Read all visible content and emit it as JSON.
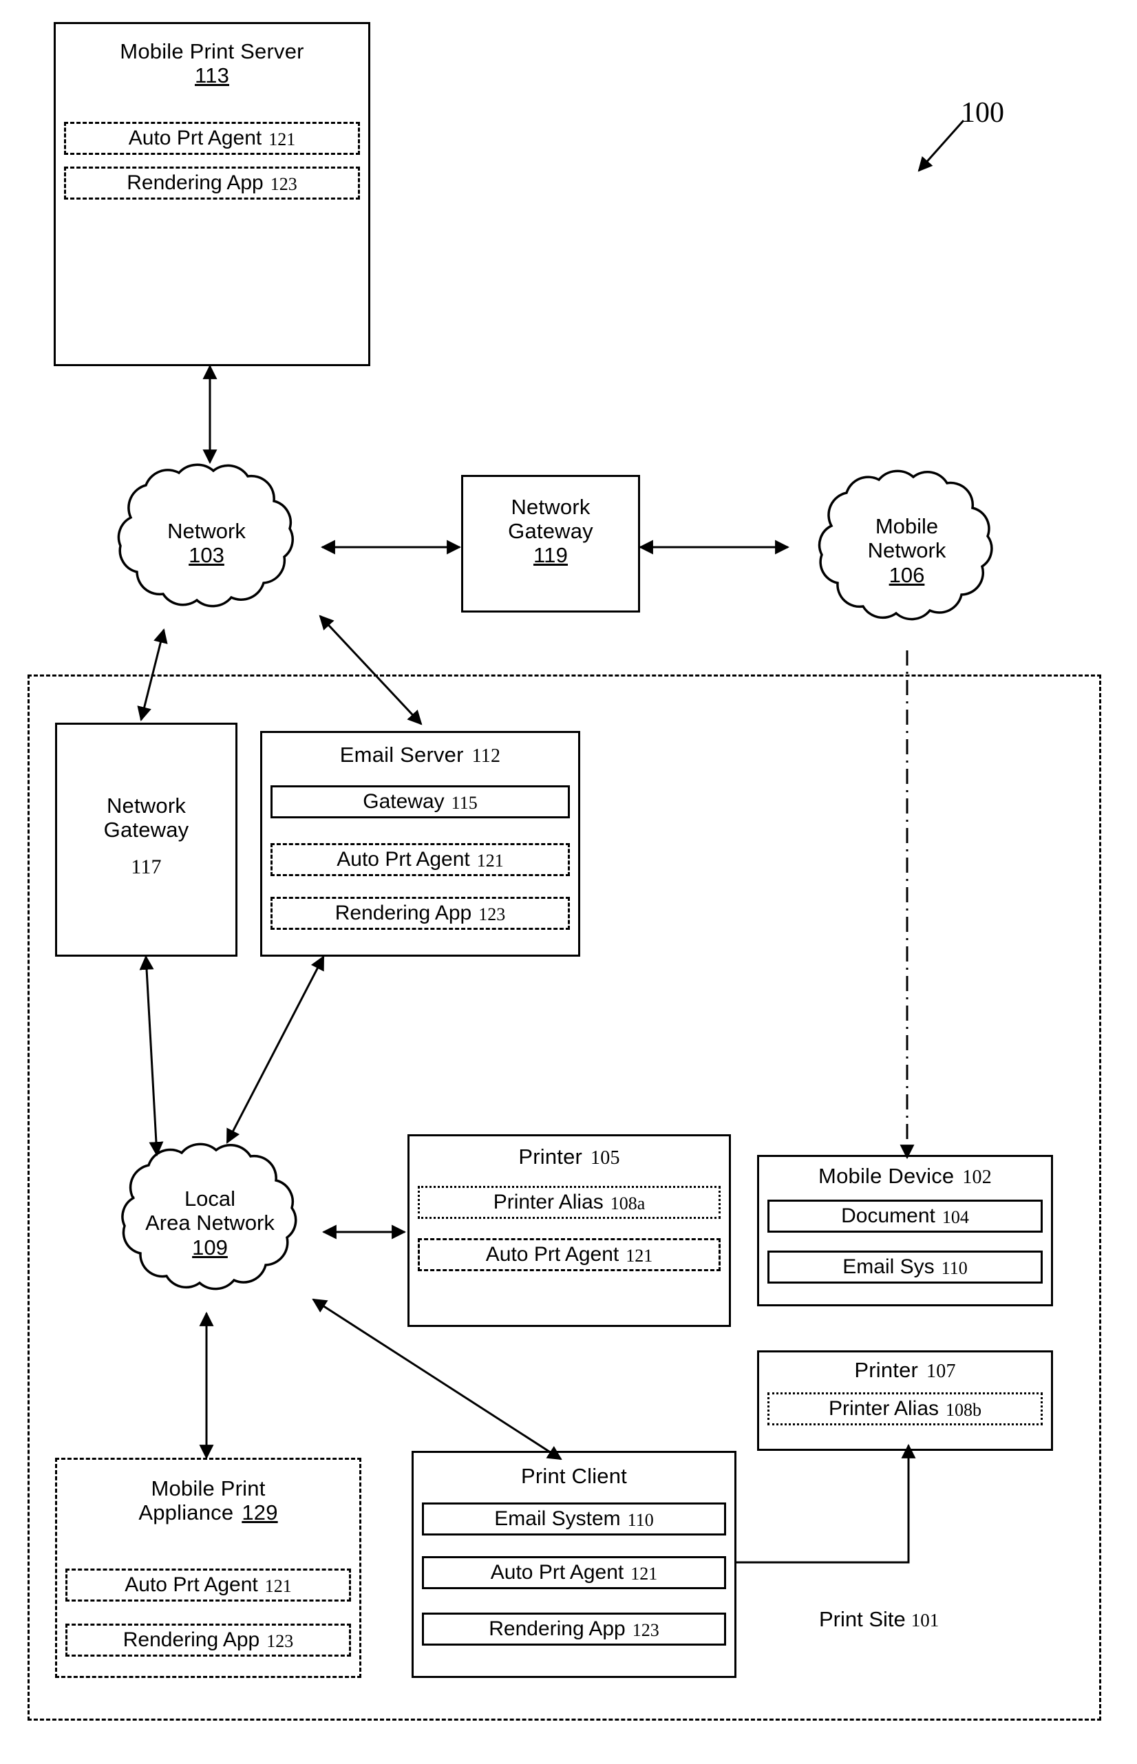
{
  "figure": {
    "number": "100",
    "print_site": {
      "label": "Print Site",
      "number": "101"
    }
  },
  "nodes": {
    "mobile_print_server": {
      "title": "Mobile Print Server",
      "number": "113",
      "modules": [
        {
          "label": "Auto Prt Agent",
          "number": "121",
          "style": "dashed"
        },
        {
          "label": "Rendering App",
          "number": "123",
          "style": "dashed"
        }
      ]
    },
    "network": {
      "label_line1": "Network",
      "number": "103"
    },
    "network_gateway_119": {
      "line1": "Network",
      "line2": "Gateway",
      "number": "119"
    },
    "mobile_network": {
      "line1": "Mobile",
      "line2": "Network",
      "number": "106"
    },
    "network_gateway_117": {
      "line1": "Network",
      "line2": "Gateway",
      "number": "117"
    },
    "email_server": {
      "title": "Email Server",
      "number": "112",
      "modules": [
        {
          "label": "Gateway",
          "number": "115",
          "style": "solid"
        },
        {
          "label": "Auto Prt Agent",
          "number": "121",
          "style": "dashed"
        },
        {
          "label": "Rendering App",
          "number": "123",
          "style": "dashed"
        }
      ]
    },
    "local_area_network": {
      "line1": "Local",
      "line2": "Area Network",
      "number": "109"
    },
    "printer_105": {
      "title": "Printer",
      "number": "105",
      "modules": [
        {
          "label": "Printer Alias",
          "number": "108a",
          "style": "dotted"
        },
        {
          "label": "Auto Prt Agent",
          "number": "121",
          "style": "dashed"
        }
      ]
    },
    "mobile_device": {
      "title": "Mobile Device",
      "number": "102",
      "modules": [
        {
          "label": "Document",
          "number": "104",
          "style": "solid"
        },
        {
          "label": "Email Sys",
          "number": "110",
          "style": "solid"
        }
      ]
    },
    "printer_107": {
      "title": "Printer",
      "number": "107",
      "modules": [
        {
          "label": "Printer Alias",
          "number": "108b",
          "style": "dotted"
        }
      ]
    },
    "mobile_print_appliance": {
      "title_line1": "Mobile Print",
      "title_line2": "Appliance",
      "number": "129",
      "modules": [
        {
          "label": "Auto Prt Agent",
          "number": "121",
          "style": "dashed"
        },
        {
          "label": "Rendering App",
          "number": "123",
          "style": "dashed"
        }
      ]
    },
    "print_client": {
      "title": "Print Client",
      "number": "",
      "modules": [
        {
          "label": "Email System",
          "number": "110",
          "style": "solid"
        },
        {
          "label": "Auto Prt Agent",
          "number": "121",
          "style": "solid"
        },
        {
          "label": "Rendering App",
          "number": "123",
          "style": "solid"
        }
      ]
    }
  },
  "colors": {
    "ink": "#000000",
    "paper": "#ffffff"
  }
}
